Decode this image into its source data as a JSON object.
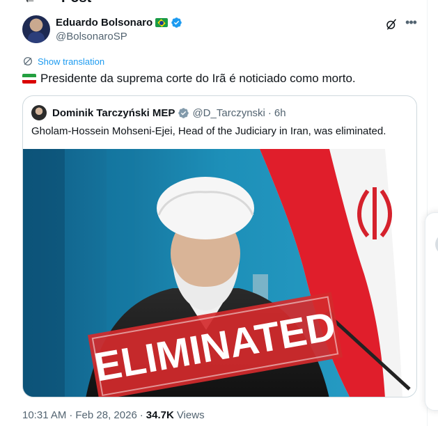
{
  "page": {
    "title": "Post"
  },
  "author": {
    "name": "Eduardo Bolsonaro",
    "flag_emoji": "🇧🇷",
    "handle": "@BolsonaroSP"
  },
  "translate": {
    "label": "Show translation"
  },
  "post": {
    "flag_emoji": "🇮🇷",
    "text": "Presidente da suprema corte do Irã é noticiado como morto."
  },
  "quote": {
    "name": "Dominik Tarczyński MEP",
    "handle": "@D_Tarczynski",
    "separator": "·",
    "time": "6h",
    "text": "Gholam-Hossein Mohseni-Ejei, Head of the Judiciary in Iran, was eliminated.",
    "image_overlay": "ELIMINATED"
  },
  "footer": {
    "time": "10:31 AM",
    "sep1": "·",
    "date": "Feb 28, 2026",
    "sep2": "·",
    "views_count": "34.7K",
    "views_label": "Views"
  },
  "colors": {
    "link": "#1d9bf0",
    "muted": "#536471",
    "verified": "#1d9bf0",
    "stamp_red": "#d42a2d"
  },
  "icons": [
    "back-arrow-icon",
    "verified-badge-icon",
    "grok-icon",
    "more-icon",
    "globe-icon"
  ]
}
